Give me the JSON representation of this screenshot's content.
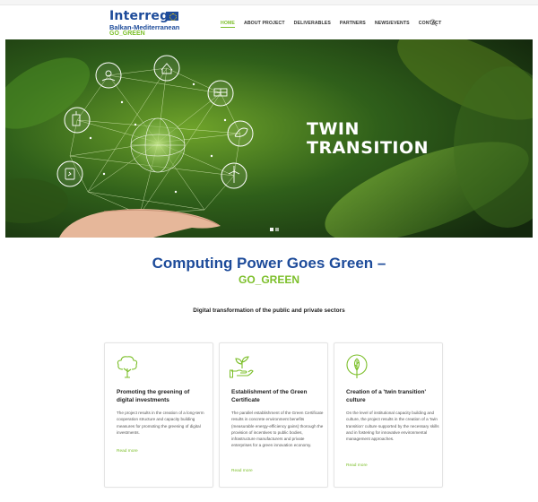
{
  "header": {
    "logo": {
      "brand": "Interreg",
      "region": "Balkan-Mediterranean",
      "project": "GO_GREEN"
    },
    "nav": [
      "HOME",
      "ABOUT PROJECT",
      "DELIVERABLES",
      "PARTNERS",
      "NEWS/EVENTS",
      "CONTACT"
    ],
    "active_nav": "HOME"
  },
  "hero": {
    "title_line1": "TWIN",
    "title_line2": "TRANSITION",
    "slides": 2,
    "active_slide": 1
  },
  "intro": {
    "title": "Computing Power Goes Green –",
    "subtitle": "GO_GREEN",
    "tagline": "Digital transformation of the public and private sectors"
  },
  "cards": [
    {
      "icon": "tree-icon",
      "title": "Promoting the greening of digital investments",
      "body": "The project results in the creation of a long-term cooperation structure and capacity building measures for promoting the greening of digital investments.",
      "link": "Read more"
    },
    {
      "icon": "plant-in-hand-icon",
      "title": "Establishment of the Green Certificate",
      "body": "The parallel establishment of the Green Certificate results in concrete environment benefits (measurable energy-efficiency gains) thorough the provision of incentives to public bodies, infrastructure manufacturers and private enterprises for a green innovation economy.",
      "link": "Read more"
    },
    {
      "icon": "leaf-circle-icon",
      "title": "Creation of a 'twin transition' culture",
      "body": "On the level of institutional capacity building and culture, the project results in the creation of a 'twin transition' culture supported by the necessary skills and in fostering for innovative environmental management approaches.",
      "link": "Read more"
    }
  ],
  "colors": {
    "blue": "#1d4b9a",
    "green": "#7cbf2a"
  }
}
